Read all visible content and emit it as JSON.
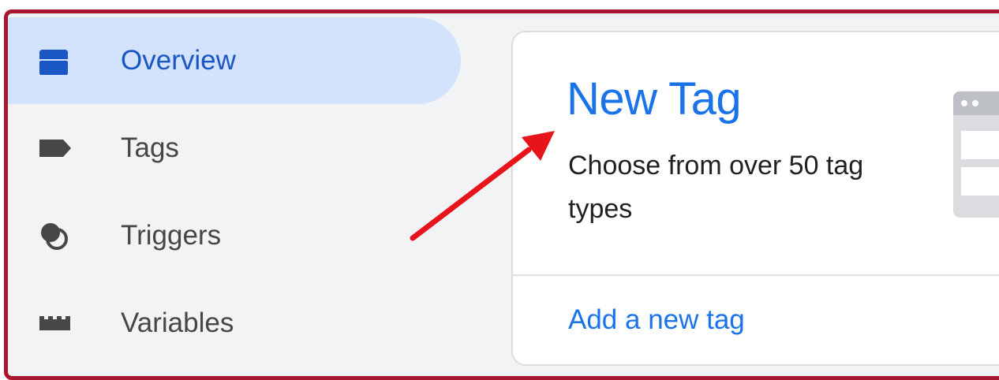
{
  "sidebar": {
    "items": [
      {
        "label": "Overview",
        "icon": "overview-icon",
        "active": true
      },
      {
        "label": "Tags",
        "icon": "tag-icon",
        "active": false
      },
      {
        "label": "Triggers",
        "icon": "triggers-icon",
        "active": false
      },
      {
        "label": "Variables",
        "icon": "variables-icon",
        "active": false
      }
    ]
  },
  "card": {
    "title": "New Tag",
    "description": "Choose from over 50 tag types",
    "link": "Add a new tag",
    "illustration_icon": "browser-window-icon"
  },
  "colors": {
    "frame_border": "#a8162f",
    "active_bg": "#d3e3fd",
    "link_blue": "#1a73e8",
    "annotation_arrow": "#e8141c"
  }
}
